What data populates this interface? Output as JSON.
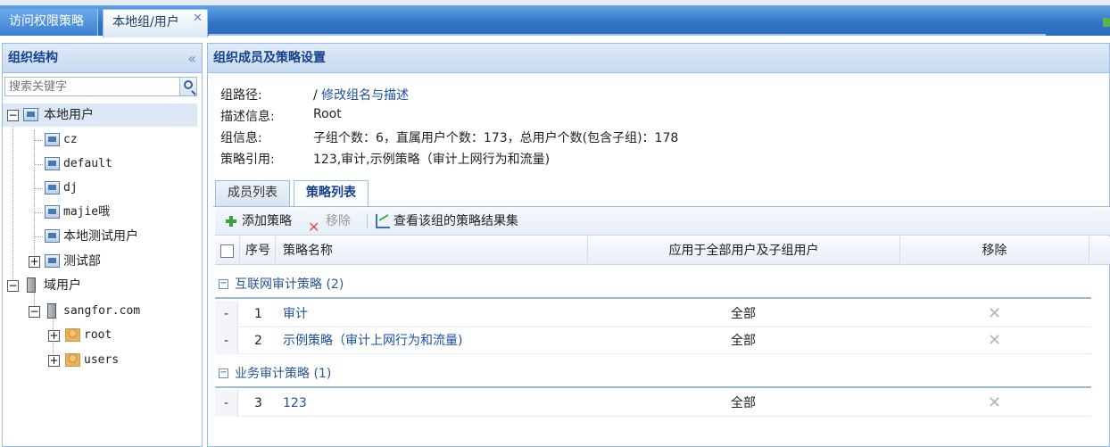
{
  "top_tabs": [
    {
      "label": "访问权限策略"
    },
    {
      "label": "本地组/用户",
      "close": "✕"
    }
  ],
  "left_panel": {
    "title": "组织结构",
    "collapse": "«",
    "search_placeholder": "搜索关键字",
    "tree": {
      "local_root": "本地用户",
      "local_children": [
        "cz",
        "default",
        "dj",
        "majie哦",
        "本地测试用户",
        "测试部"
      ],
      "domain_root": "域用户",
      "domain_node": "sangfor.com",
      "domain_children": [
        "root",
        "users"
      ]
    }
  },
  "right_panel": {
    "title": "组织成员及策略设置",
    "info": {
      "path_label": "组路径:",
      "path_prefix": "/",
      "path_link": "修改组名与描述",
      "desc_label": "描述信息:",
      "desc_value": "Root",
      "group_label": "组信息:",
      "group_value": "子组个数：6，直属用户个数：173，总用户个数(包含子组)：178",
      "policy_label": "策略引用:",
      "policy_value": "123,审计,示例策略（审计上网行为和流量)"
    },
    "tabs": [
      "成员列表",
      "策略列表"
    ],
    "toolbar": {
      "add": "添加策略",
      "remove": "移除",
      "view": "查看该组的策略结果集"
    },
    "columns": {
      "index": "序号",
      "name": "策略名称",
      "apply": "应用于全部用户及子组用户",
      "remove": "移除"
    },
    "groups": [
      {
        "title": "互联网审计策略 (2)",
        "rows": [
          {
            "expander": "-",
            "index": "1",
            "name": "审计",
            "apply": "全部",
            "remove": "✕"
          },
          {
            "expander": "-",
            "index": "2",
            "name": "示例策略（审计上网行为和流量)",
            "apply": "全部",
            "remove": "✕"
          }
        ]
      },
      {
        "title": "业务审计策略 (1)",
        "rows": [
          {
            "expander": "-",
            "index": "3",
            "name": "123",
            "apply": "全部",
            "remove": "✕"
          }
        ]
      }
    ]
  },
  "icons": {
    "group_toggle": "⊟",
    "tree_minus": "−",
    "tree_plus": "+"
  }
}
